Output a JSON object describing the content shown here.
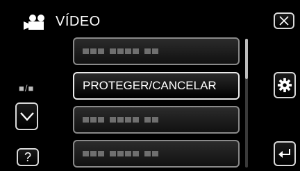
{
  "header": {
    "title": "VÍDEO",
    "mode_icon": "movie-camera-icon"
  },
  "menu": {
    "items": [
      {
        "label": "",
        "state": "obscured"
      },
      {
        "label": "PROTEGER/CANCELAR",
        "state": "selected"
      },
      {
        "label": "",
        "state": "obscured"
      },
      {
        "label": "",
        "state": "obscured"
      }
    ]
  },
  "side_left": {
    "page_indicator": "■/■",
    "down_icon": "chevron-down-icon",
    "help_label": "?"
  },
  "side_right": {
    "close_icon": "close-icon",
    "settings_icon": "gear-icon",
    "back_icon": "return-arrow-icon"
  },
  "colors": {
    "background": "#000000",
    "button_border": "#d9d9d9",
    "item_border": "#8a8a8a",
    "placeholder_text": "#6f6f6f"
  }
}
